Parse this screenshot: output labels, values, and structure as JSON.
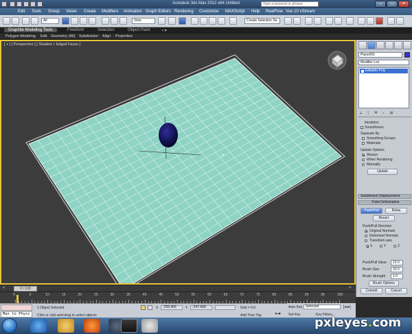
{
  "titlebar": {
    "title": "Autodesk 3ds Max  2012 x64      Untitled",
    "search_placeholder": "Type a keyword or phrase"
  },
  "menubar": {
    "items": [
      "Edit",
      "Tools",
      "Group",
      "Views",
      "Create",
      "Modifiers",
      "Animation",
      "Graph Editors",
      "Rendering",
      "Customize",
      "MAXScript",
      "Help",
      "RealFlow",
      "Vue 10 xStream"
    ]
  },
  "toolbar": {
    "selection_filter": "All",
    "ref_coord": "View",
    "named_selection": "Create Selection Se"
  },
  "ribbon": {
    "tabs": [
      "Graphite Modeling Tools",
      "Freeform",
      "Selection",
      "Object Paint"
    ],
    "subtabs": [
      "Polygon Modeling",
      "Edit",
      "Geometry (All)",
      "Subdivision",
      "Align",
      "Properties"
    ]
  },
  "viewport": {
    "label": "[ + ] [ Perspective ] [ Shaded + Edged Faces ]"
  },
  "command_panel": {
    "object_name": "Plane001",
    "modifier_list": "Modifier List",
    "stack_item": "Editable Poly",
    "subdiv": {
      "iterations_label": "Iterations",
      "smoothness_label": "Smoothness"
    },
    "separate_by": {
      "title": "Separate By",
      "smoothing_groups": "Smoothing Groups",
      "materials": "Materials"
    },
    "update_options": {
      "title": "Update Options",
      "always": "Always",
      "when_rendering": "When Rendering",
      "manually": "Manually",
      "update_button": "Update"
    },
    "rollouts": {
      "subdivision_displacement": "Subdivision Displacement",
      "paint_deformation": "Paint Deformation"
    },
    "paint_deformation": {
      "push_pull": "Push/Pull",
      "relax": "Relax",
      "revert": "Revert",
      "direction_title": "Push/Pull Direction",
      "original_normals": "Original Normals",
      "deformed_normals": "Deformed Normals",
      "transform_axis": "Transform axis",
      "axis_x": "X",
      "axis_y": "Y",
      "axis_z": "Z",
      "push_pull_value_label": "Push/Pull Value",
      "push_pull_value": "10.0",
      "brush_size_label": "Brush Size",
      "brush_size": "20.0",
      "brush_strength_label": "Brush Strength",
      "brush_strength": "1.0",
      "brush_options": "Brush Options",
      "commit": "Commit",
      "cancel": "Cancel"
    }
  },
  "timeslider": {
    "position": "0 / 100"
  },
  "trackbar": {
    "ticks": [
      "0",
      "5",
      "10",
      "15",
      "20",
      "25",
      "30",
      "35",
      "40",
      "45",
      "50",
      "55",
      "60",
      "65",
      "70",
      "75",
      "80",
      "85",
      "90",
      "95",
      "100"
    ]
  },
  "statusbar": {
    "maxscript_text": "Max to Physc",
    "selection_status": "1 Object Selected",
    "prompt": "Click or click-and-drag to select objects",
    "x_label": "X",
    "x_value": "-255.406",
    "y_label": "Y",
    "y_value": "-247.668",
    "grid": "Grid = 0.0",
    "add_time_tag": "Add Time Tag",
    "auto_key": "Auto Key",
    "set_key": "Set Key",
    "selected_dropdown": "Selected",
    "key_filters": "Key Filters..."
  },
  "watermark": {
    "text_main": "pxleyes",
    "text_dot": ".",
    "text_tail": "com"
  },
  "colors": {
    "plane_fill": "#8fd3c4",
    "grid_line": "#e8fbf6",
    "sphere": "#0b0b4a",
    "viewport_bg": "#3c3c3c",
    "active_border": "#e8c53a"
  }
}
